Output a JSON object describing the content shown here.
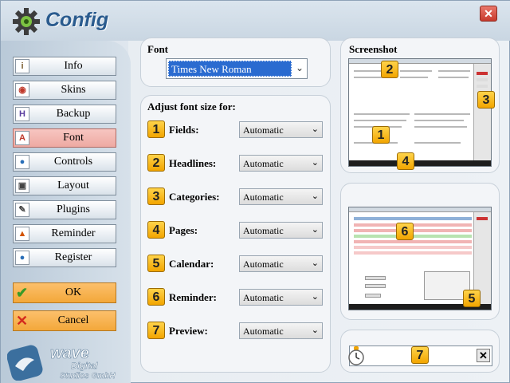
{
  "window": {
    "title": "Config",
    "close_glyph": "✕"
  },
  "sidebar": {
    "items": [
      {
        "label": "Info",
        "icon": "info-icon",
        "glyph": "i",
        "color": "#7a5c2e",
        "active": false
      },
      {
        "label": "Skins",
        "icon": "skins-icon",
        "glyph": "◉",
        "color": "#c0392b",
        "active": false
      },
      {
        "label": "Backup",
        "icon": "backup-icon",
        "glyph": "H",
        "color": "#5b3fa0",
        "active": false
      },
      {
        "label": "Font",
        "icon": "font-icon",
        "glyph": "A",
        "color": "#c0392b",
        "active": true
      },
      {
        "label": "Controls",
        "icon": "controls-icon",
        "glyph": "●",
        "color": "#2a6fb8",
        "active": false
      },
      {
        "label": "Layout",
        "icon": "layout-icon",
        "glyph": "▣",
        "color": "#444444",
        "active": false
      },
      {
        "label": "Plugins",
        "icon": "plugins-icon",
        "glyph": "✎",
        "color": "#444444",
        "active": false
      },
      {
        "label": "Reminder",
        "icon": "reminder-icon",
        "glyph": "▲",
        "color": "#d35400",
        "active": false
      },
      {
        "label": "Register",
        "icon": "register-icon",
        "glyph": "●",
        "color": "#2a6fb8",
        "active": false
      }
    ],
    "ok_label": "OK",
    "cancel_label": "Cancel"
  },
  "logo": {
    "line1": "wave",
    "line2": "Digital",
    "line3": "Studios GmbH"
  },
  "font_panel": {
    "heading": "Font",
    "selected_font": "Times New Roman"
  },
  "adjust_panel": {
    "heading": "Adjust font size for:",
    "rows": [
      {
        "num": "1",
        "label": "Fields:",
        "value": "Automatic"
      },
      {
        "num": "2",
        "label": "Headlines:",
        "value": "Automatic"
      },
      {
        "num": "3",
        "label": "Categories:",
        "value": "Automatic"
      },
      {
        "num": "4",
        "label": "Pages:",
        "value": "Automatic"
      },
      {
        "num": "5",
        "label": "Calendar:",
        "value": "Automatic"
      },
      {
        "num": "6",
        "label": "Reminder:",
        "value": "Automatic"
      },
      {
        "num": "7",
        "label": "Preview:",
        "value": "Automatic"
      }
    ]
  },
  "screenshot_panel": {
    "heading": "Screenshot",
    "markers_top": [
      "2",
      "3",
      "1",
      "4"
    ],
    "markers_bottom": [
      "6",
      "5"
    ]
  },
  "reminder_preview": {
    "marker": "7"
  }
}
